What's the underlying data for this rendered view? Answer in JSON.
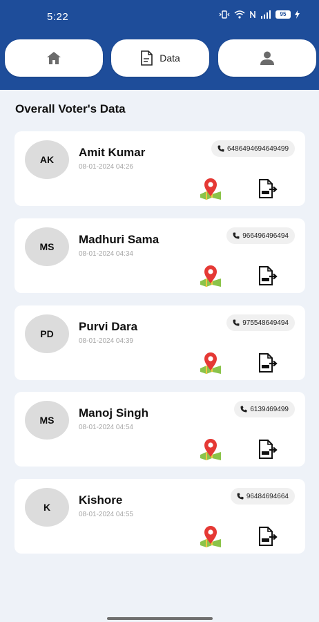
{
  "status_bar": {
    "time": "5:22",
    "battery": "95"
  },
  "tabs": [
    {
      "name": "home",
      "label": ""
    },
    {
      "name": "data",
      "label": "Data"
    },
    {
      "name": "profile",
      "label": ""
    }
  ],
  "page_title": "Overall Voter's Data",
  "voters": [
    {
      "initials": "AK",
      "name": "Amit Kumar",
      "datetime": "08-01-2024 04:26",
      "phone": "6486494694649499"
    },
    {
      "initials": "MS",
      "name": "Madhuri Sama",
      "datetime": "08-01-2024 04:34",
      "phone": "966496496494"
    },
    {
      "initials": "PD",
      "name": "Purvi Dara",
      "datetime": "08-01-2024 04:39",
      "phone": "975548649494"
    },
    {
      "initials": "MS",
      "name": "Manoj Singh",
      "datetime": "08-01-2024 04:54",
      "phone": "6139469499"
    },
    {
      "initials": "K",
      "name": "Kishore",
      "datetime": "08-01-2024 04:55",
      "phone": "96484694664"
    }
  ],
  "colors": {
    "header": "#1e4d9a",
    "background": "#eef2f8",
    "card": "#ffffff",
    "map_pin": "#e53935"
  }
}
